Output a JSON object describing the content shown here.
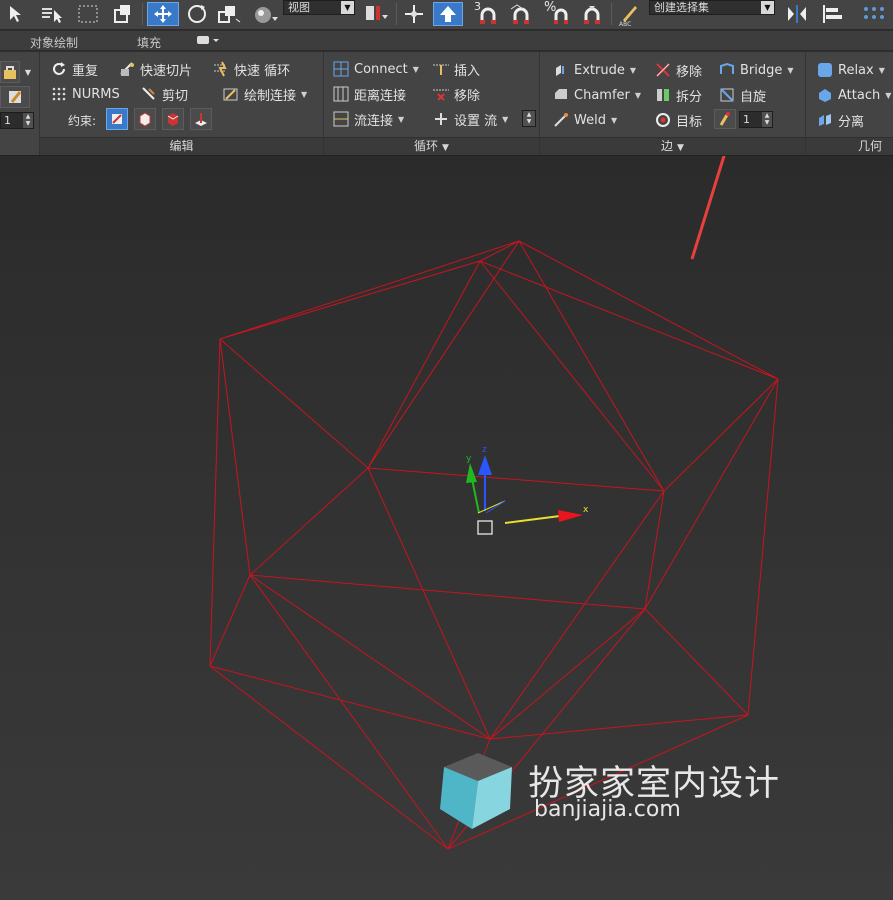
{
  "toolbar": {
    "view_combo": "视图",
    "selection_set_combo": "创建选择集",
    "snap_3_label": "3",
    "percent_label": "%"
  },
  "tabs": {
    "object_paint": "对象绘制",
    "populate": "填充"
  },
  "edit_group": {
    "repeat": "重复",
    "quickslice": "快速切片",
    "swiftloop": "快速 循环",
    "nurms": "NURMS",
    "cut": "剪切",
    "paint_connect": "绘制连接",
    "constraints": "约束:",
    "spin_value": "1",
    "label": "编辑"
  },
  "loops_group": {
    "connect": "Connect",
    "insert": "插入",
    "distance_connect": "距离连接",
    "remove": "移除",
    "flow_connect": "流连接",
    "set_flow": "设置 流",
    "label": "循环"
  },
  "edges_group": {
    "extrude": "Extrude",
    "remove": "移除",
    "bridge": "Bridge",
    "chamfer": "Chamfer",
    "split": "拆分",
    "spin": "自旋",
    "weld": "Weld",
    "target": "目标",
    "spin_value": "1",
    "label": "边"
  },
  "geometry_group": {
    "relax": "Relax",
    "attach": "Attach",
    "detach": "分离",
    "label": "几何体"
  },
  "gizmo": {
    "x": "x",
    "y": "y",
    "z": "z"
  },
  "watermark": {
    "title": "扮家家室内设计",
    "url": "banjiajia.com"
  },
  "colors": {
    "wire": "#c8141e",
    "highlight_arrow": "#e8413c",
    "ui_bg": "#444444",
    "viewport_bg": "#2e2e2e",
    "accent_blue": "#3a78c8"
  }
}
